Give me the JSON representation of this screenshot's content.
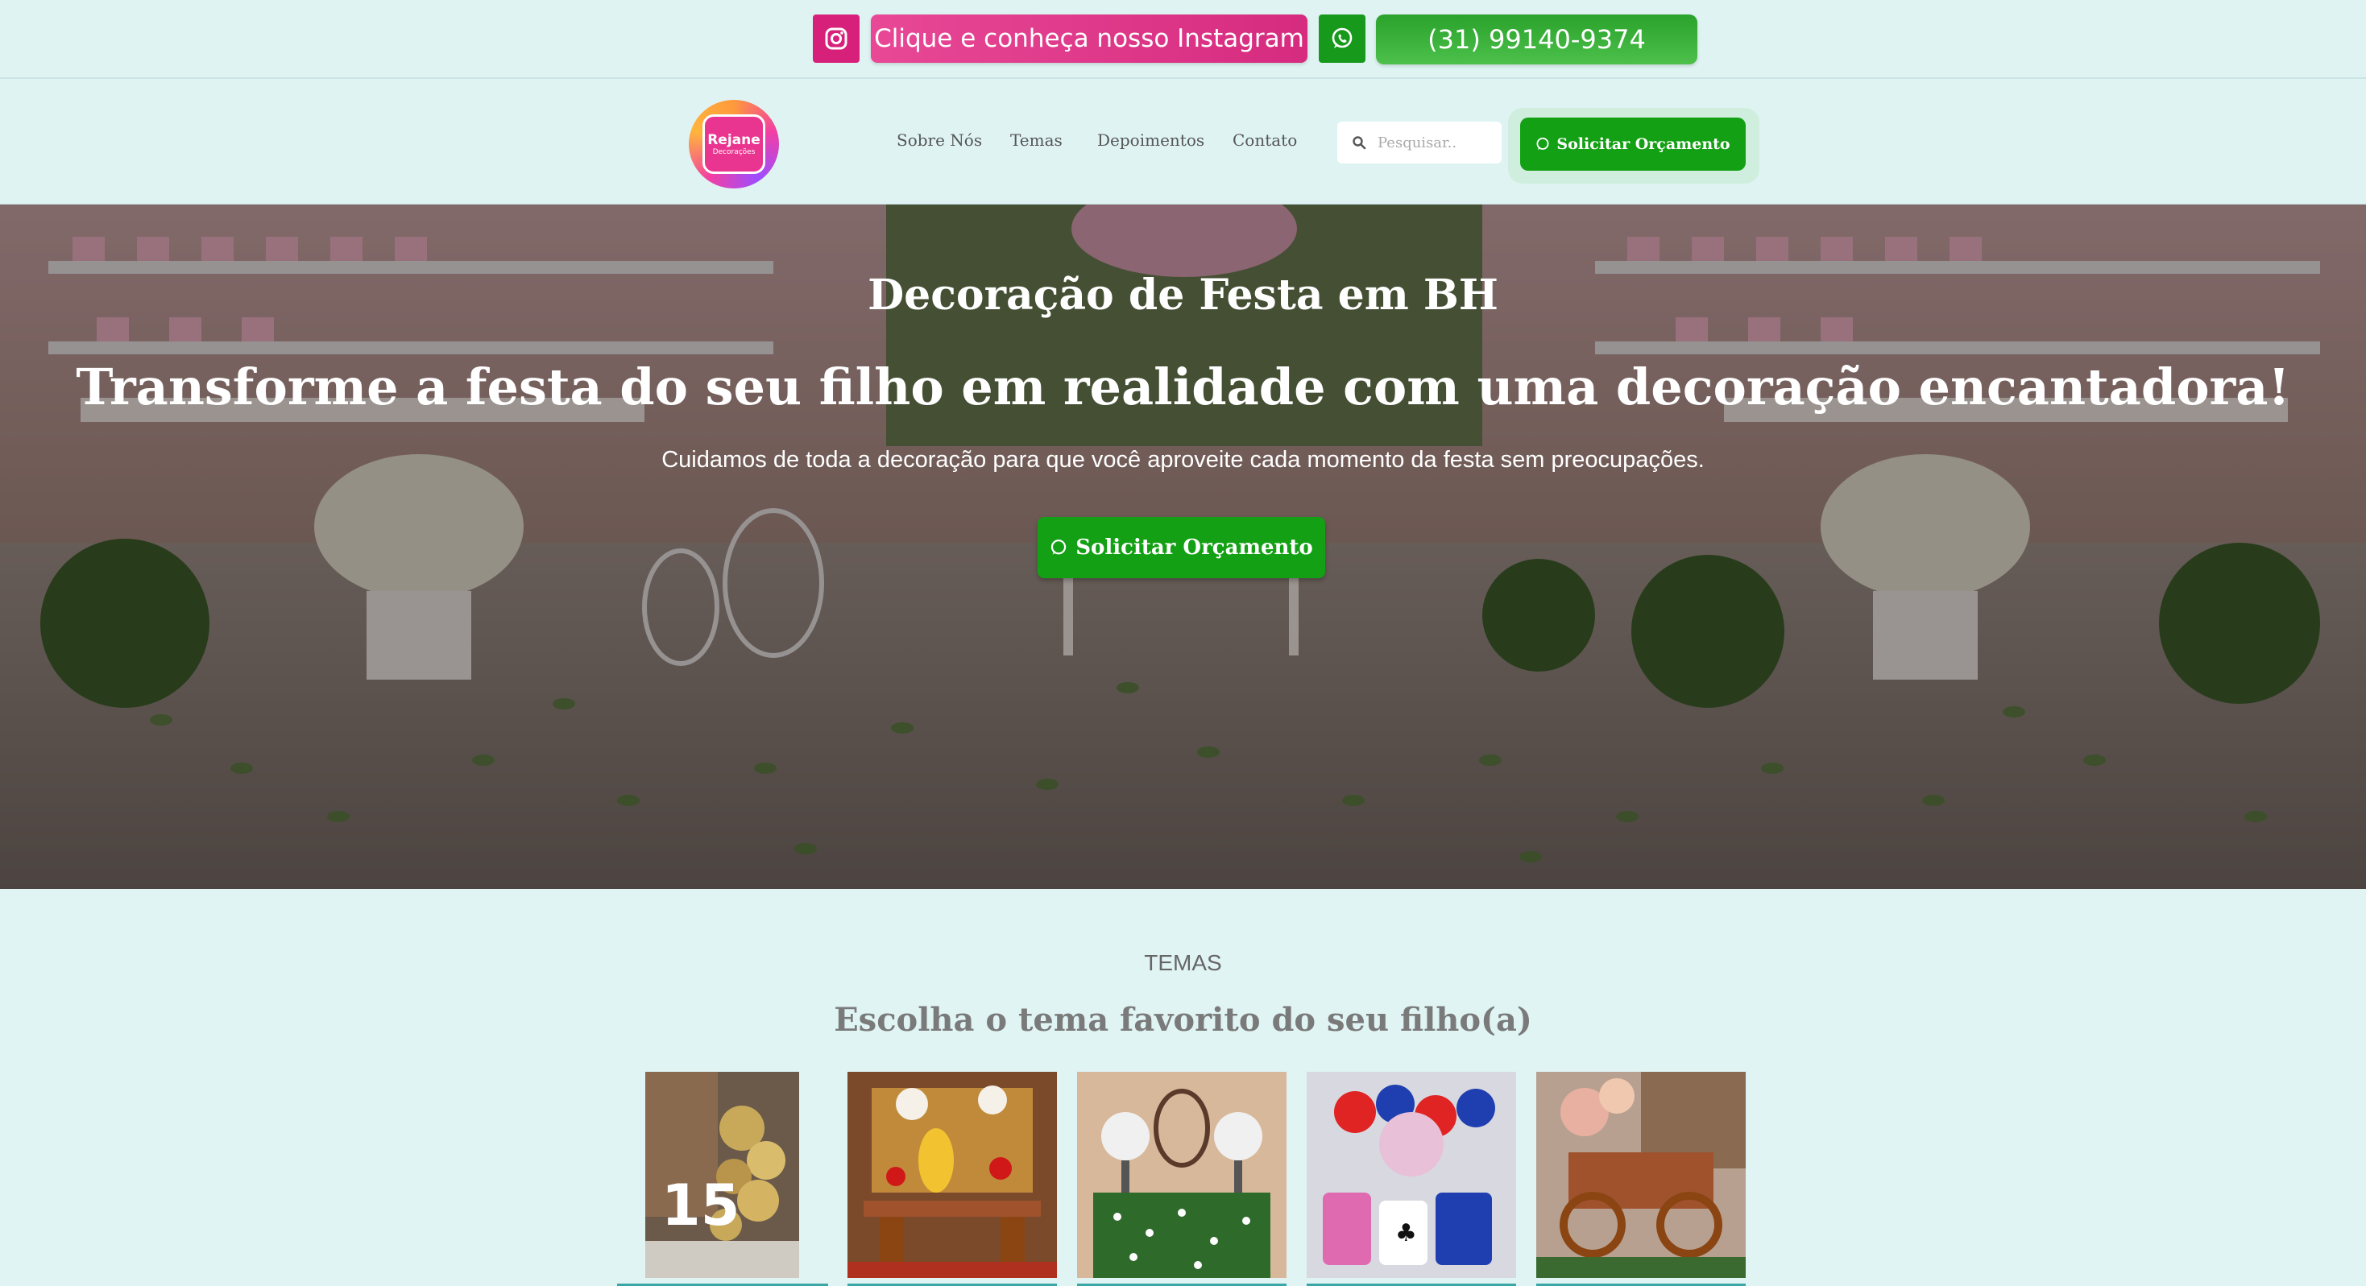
{
  "topbar": {
    "instagram_label": "Clique e conheça nosso Instagram",
    "phone": "(31) 99140-9374"
  },
  "logo": {
    "name": "Rejane",
    "subtitle": "Decorações"
  },
  "nav": {
    "items": [
      "Sobre Nós",
      "Temas",
      "Depoimentos",
      "Contato"
    ],
    "search_placeholder": "Pesquisar..",
    "cta": "Solicitar Orçamento"
  },
  "hero": {
    "kicker": "Decoração de Festa em BH",
    "title": "Transforme a festa do seu filho em realidade com uma decoração encantadora!",
    "text": "Cuidamos de toda a decoração para que você aproveite cada momento da festa sem preocupações.",
    "cta": "Solicitar Orçamento"
  },
  "temas": {
    "kicker": "TEMAS",
    "title": "Escolha o tema favorito do seu filho(a)",
    "cards": [
      {
        "name": "theme-15-anos-gold"
      },
      {
        "name": "theme-princess"
      },
      {
        "name": "theme-floral"
      },
      {
        "name": "theme-casino-red-blue"
      },
      {
        "name": "theme-western-cart"
      }
    ]
  },
  "colors": {
    "background": "#e0f4f4",
    "instagram": "#d6207a",
    "whatsapp": "#14a014"
  },
  "icons": [
    "instagram-icon",
    "whatsapp-icon",
    "search-icon"
  ]
}
